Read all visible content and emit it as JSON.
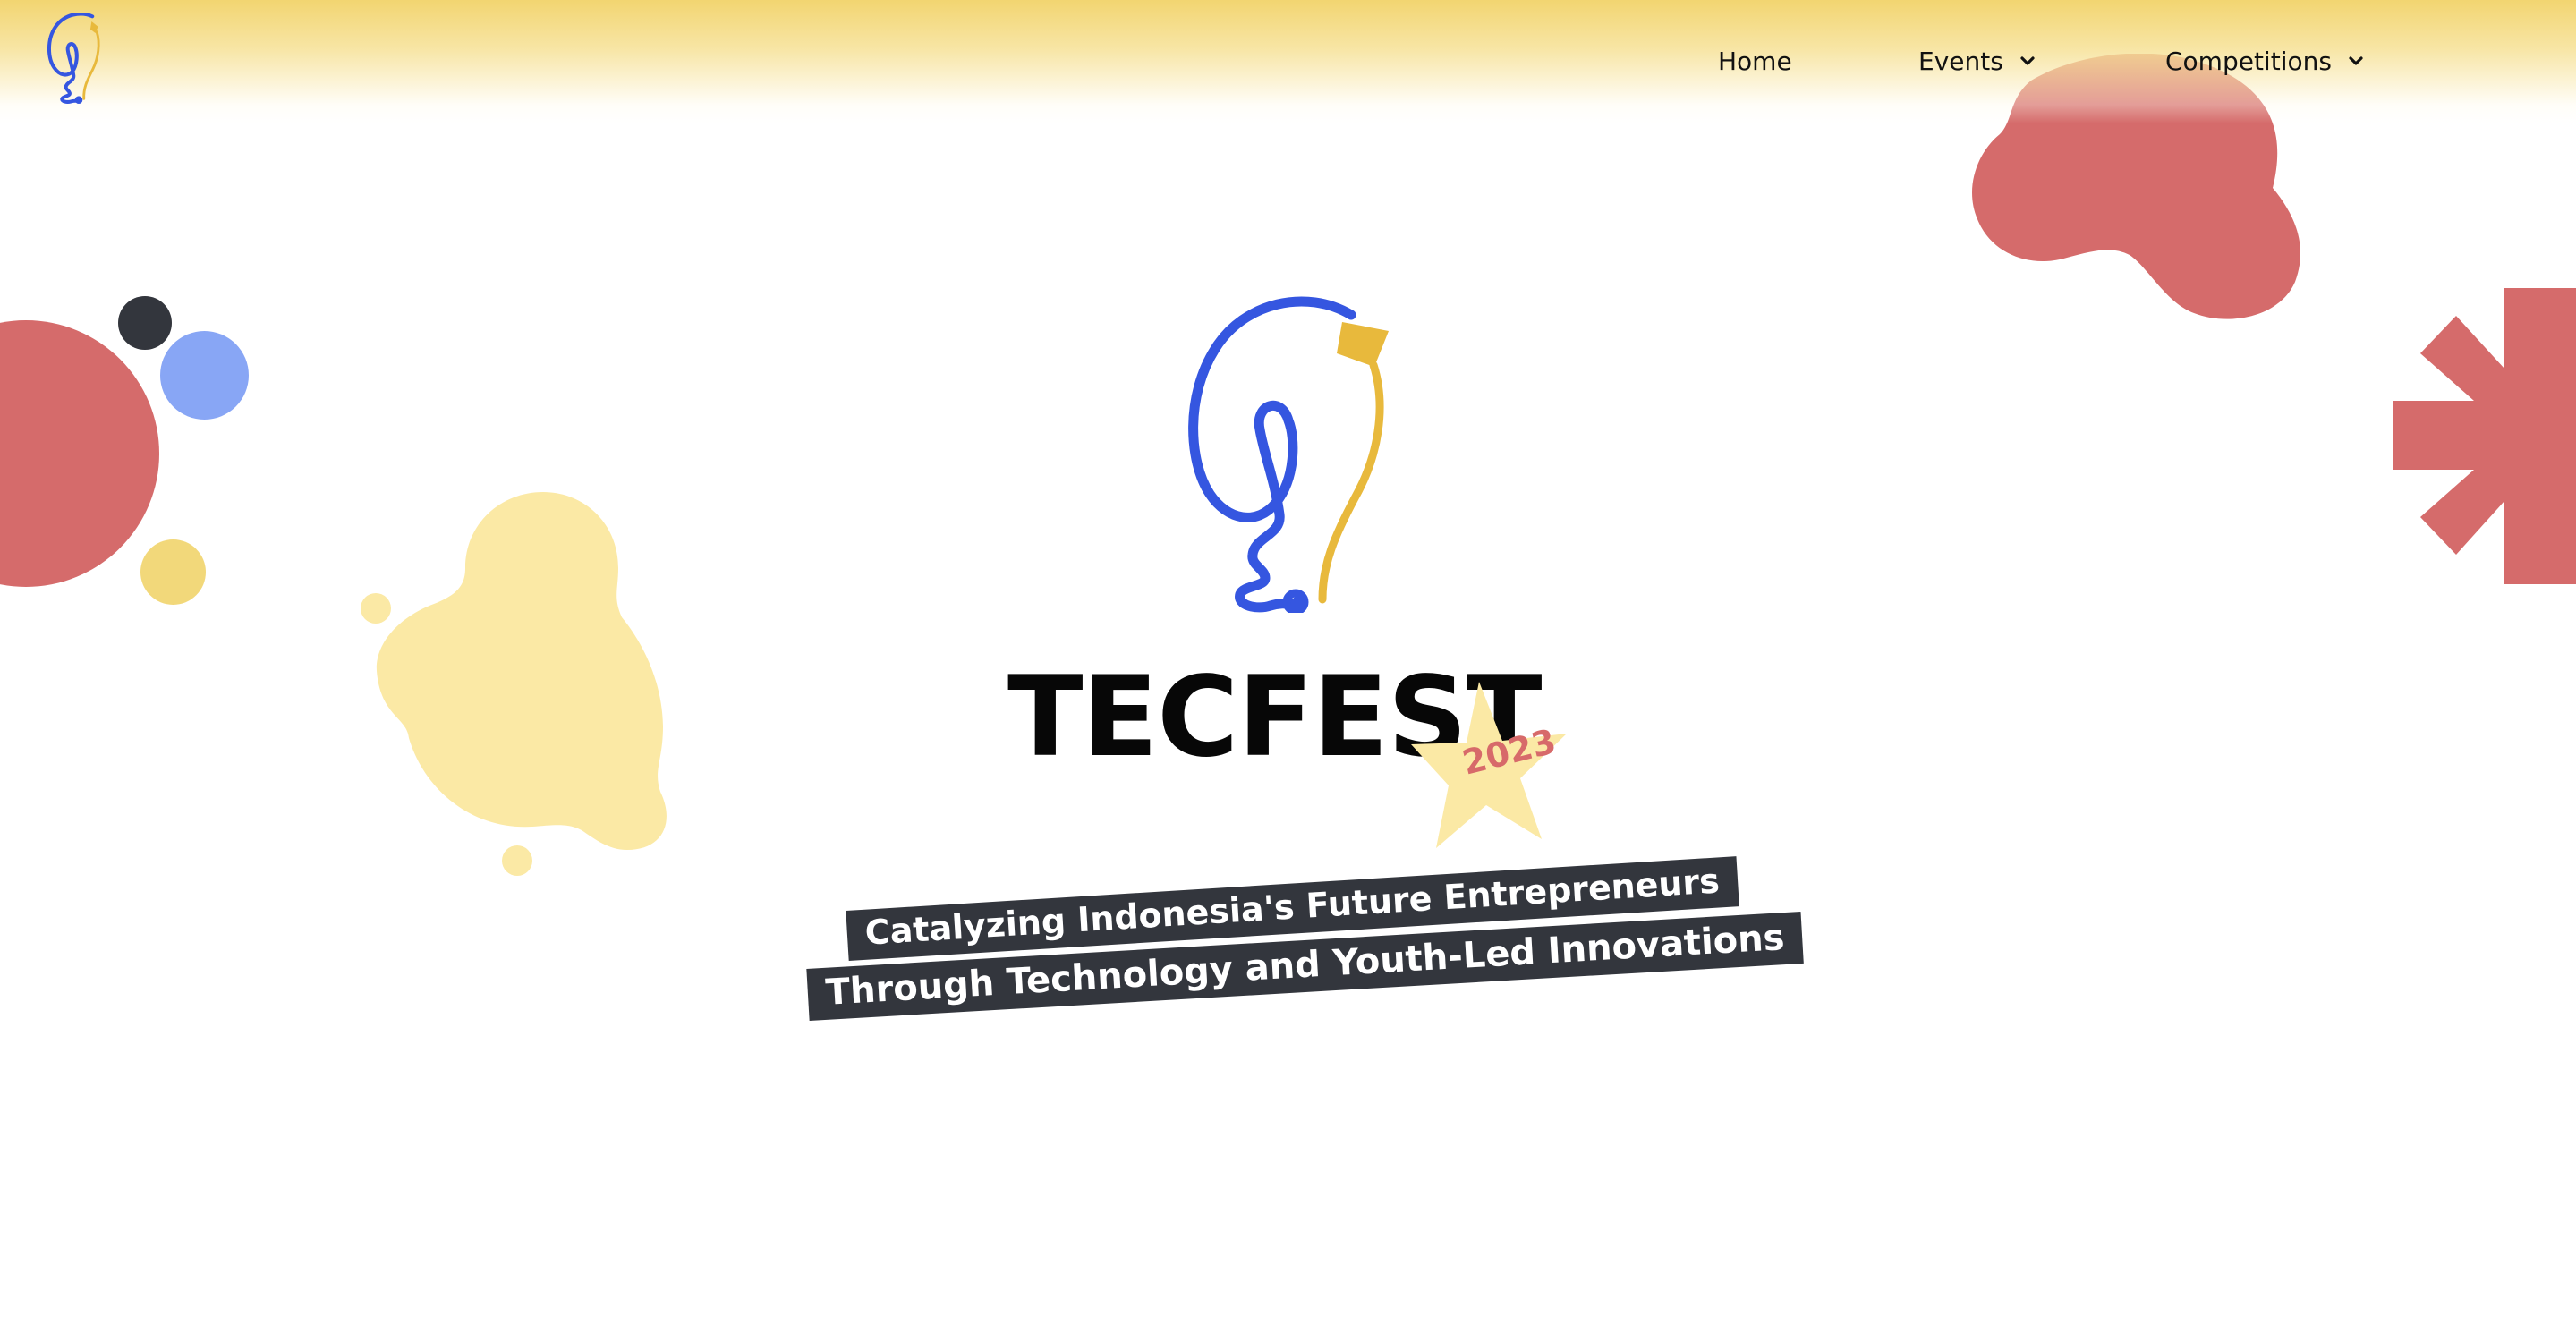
{
  "nav": {
    "items": [
      {
        "label": "Home",
        "has_dropdown": false
      },
      {
        "label": "Events",
        "has_dropdown": true
      },
      {
        "label": "Competitions",
        "has_dropdown": true
      }
    ]
  },
  "hero": {
    "title": "TECFEST",
    "badge_year": "2023",
    "tagline_lines": [
      "Catalyzing Indonesia's Future Entrepreneurs",
      "Through Technology and Youth-Led Innovations"
    ]
  },
  "icons": {
    "logo": "lightbulb-kite-logo-icon",
    "dropdown": "chevron-down-icon",
    "badge": "star-badge-icon"
  },
  "colors": {
    "header_gradient_top": "#f2d46e",
    "brand_blue": "#3556e0",
    "brand_yellow": "#e8b93c",
    "accent_red": "#d56b6b",
    "light_yellow": "#fbe9a5",
    "tagline_bg": "#33363d",
    "text_dark": "#070707"
  }
}
